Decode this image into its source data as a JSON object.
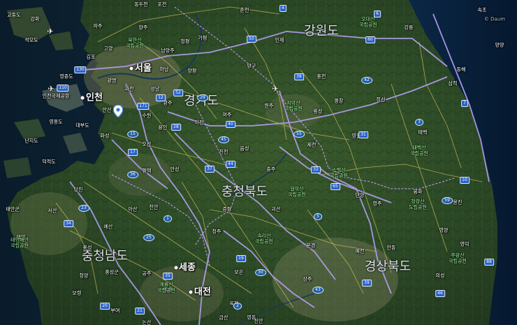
{
  "provinces": [
    {
      "name": "강원도"
    },
    {
      "name": "경기도"
    },
    {
      "name": "충청북도"
    },
    {
      "name": "충청남도"
    },
    {
      "name": "경상북도"
    }
  ],
  "major_cities": [
    {
      "name": "서울"
    },
    {
      "name": "인천"
    },
    {
      "name": "대전"
    },
    {
      "name": "세종"
    }
  ],
  "cities": [
    {
      "name": "동두천"
    },
    {
      "name": "포천"
    },
    {
      "name": "파주"
    },
    {
      "name": "양주"
    },
    {
      "name": "고양"
    },
    {
      "name": "김포"
    },
    {
      "name": "남양주"
    },
    {
      "name": "하남"
    },
    {
      "name": "광명"
    },
    {
      "name": "과천"
    },
    {
      "name": "성남"
    },
    {
      "name": "광주"
    },
    {
      "name": "안산"
    },
    {
      "name": "수원"
    },
    {
      "name": "화성"
    },
    {
      "name": "오산"
    },
    {
      "name": "용인"
    },
    {
      "name": "이천"
    },
    {
      "name": "여주"
    },
    {
      "name": "평택"
    },
    {
      "name": "안성"
    },
    {
      "name": "원주"
    },
    {
      "name": "춘천"
    },
    {
      "name": "강릉"
    },
    {
      "name": "동해"
    },
    {
      "name": "삼척"
    },
    {
      "name": "홍천"
    },
    {
      "name": "횡성"
    },
    {
      "name": "평창"
    },
    {
      "name": "정선"
    },
    {
      "name": "영월"
    },
    {
      "name": "태백"
    },
    {
      "name": "제천"
    },
    {
      "name": "충주"
    },
    {
      "name": "단양"
    },
    {
      "name": "영주"
    },
    {
      "name": "봉화"
    },
    {
      "name": "울진"
    },
    {
      "name": "청주"
    },
    {
      "name": "천안"
    },
    {
      "name": "아산"
    },
    {
      "name": "당진"
    },
    {
      "name": "서산"
    },
    {
      "name": "예산"
    },
    {
      "name": "홍성"
    },
    {
      "name": "보령"
    },
    {
      "name": "공주"
    },
    {
      "name": "계룡"
    },
    {
      "name": "논산"
    },
    {
      "name": "문경"
    },
    {
      "name": "상주"
    },
    {
      "name": "안동"
    },
    {
      "name": "영양"
    },
    {
      "name": "영덕"
    },
    {
      "name": "예천"
    },
    {
      "name": "의성"
    },
    {
      "name": "태안"
    },
    {
      "name": "진천"
    },
    {
      "name": "음성"
    },
    {
      "name": "괴산"
    },
    {
      "name": "증평"
    },
    {
      "name": "옥천"
    },
    {
      "name": "보은"
    },
    {
      "name": "영동"
    },
    {
      "name": "부여"
    },
    {
      "name": "청양"
    },
    {
      "name": "영종도"
    },
    {
      "name": "강화"
    },
    {
      "name": "석모도"
    },
    {
      "name": "교동도"
    },
    {
      "name": "인천국제공항"
    },
    {
      "name": "영흥도"
    },
    {
      "name": "덕적도"
    },
    {
      "name": "난지도"
    },
    {
      "name": "대부도"
    },
    {
      "name": "양평"
    },
    {
      "name": "가평"
    },
    {
      "name": "청평"
    },
    {
      "name": "양구"
    },
    {
      "name": "인제"
    },
    {
      "name": "속초"
    },
    {
      "name": "양양"
    },
    {
      "name": "홍성군"
    },
    {
      "name": "금산"
    },
    {
      "name": "진안"
    },
    {
      "name": "태안군"
    }
  ],
  "parks": [
    {
      "name": "오대산\n국립공원"
    },
    {
      "name": "북한산\n국립공원"
    },
    {
      "name": "치악산\n국립공원"
    },
    {
      "name": "월악산\n국립공원"
    },
    {
      "name": "소백산\n국립공원"
    },
    {
      "name": "태백산\n국립공원"
    },
    {
      "name": "청량산\n도립공원"
    },
    {
      "name": "속리산\n국립공원"
    },
    {
      "name": "계룡산\n국립공원"
    },
    {
      "name": "주왕산\n국립공원"
    },
    {
      "name": "태안해안\n국립공원"
    }
  ],
  "route_shields": [
    "1",
    "110",
    "130",
    "15",
    "17",
    "171",
    "25",
    "35",
    "40",
    "45",
    "50",
    "52",
    "55",
    "60",
    "65",
    "30",
    "19",
    "37",
    "36",
    "28",
    "31",
    "5",
    "7",
    "10",
    "3",
    "4",
    "6",
    "42",
    "38",
    "44",
    "2",
    "20",
    "21",
    "23",
    "34",
    "46",
    "59",
    "88",
    "12",
    "29",
    "32",
    "39",
    "43"
  ],
  "watermark": "© Daum",
  "colors": {
    "sea": "#0b2436",
    "land_dark": "#1d3b22",
    "land_mid": "#3b5a2e",
    "land_light": "#8a8c6a",
    "highway": "#b9a3f0",
    "local_road": "#d9c86a",
    "boundary": "#c6a0ff"
  },
  "icons": [
    "location-pin-icon",
    "airport-icon"
  ]
}
